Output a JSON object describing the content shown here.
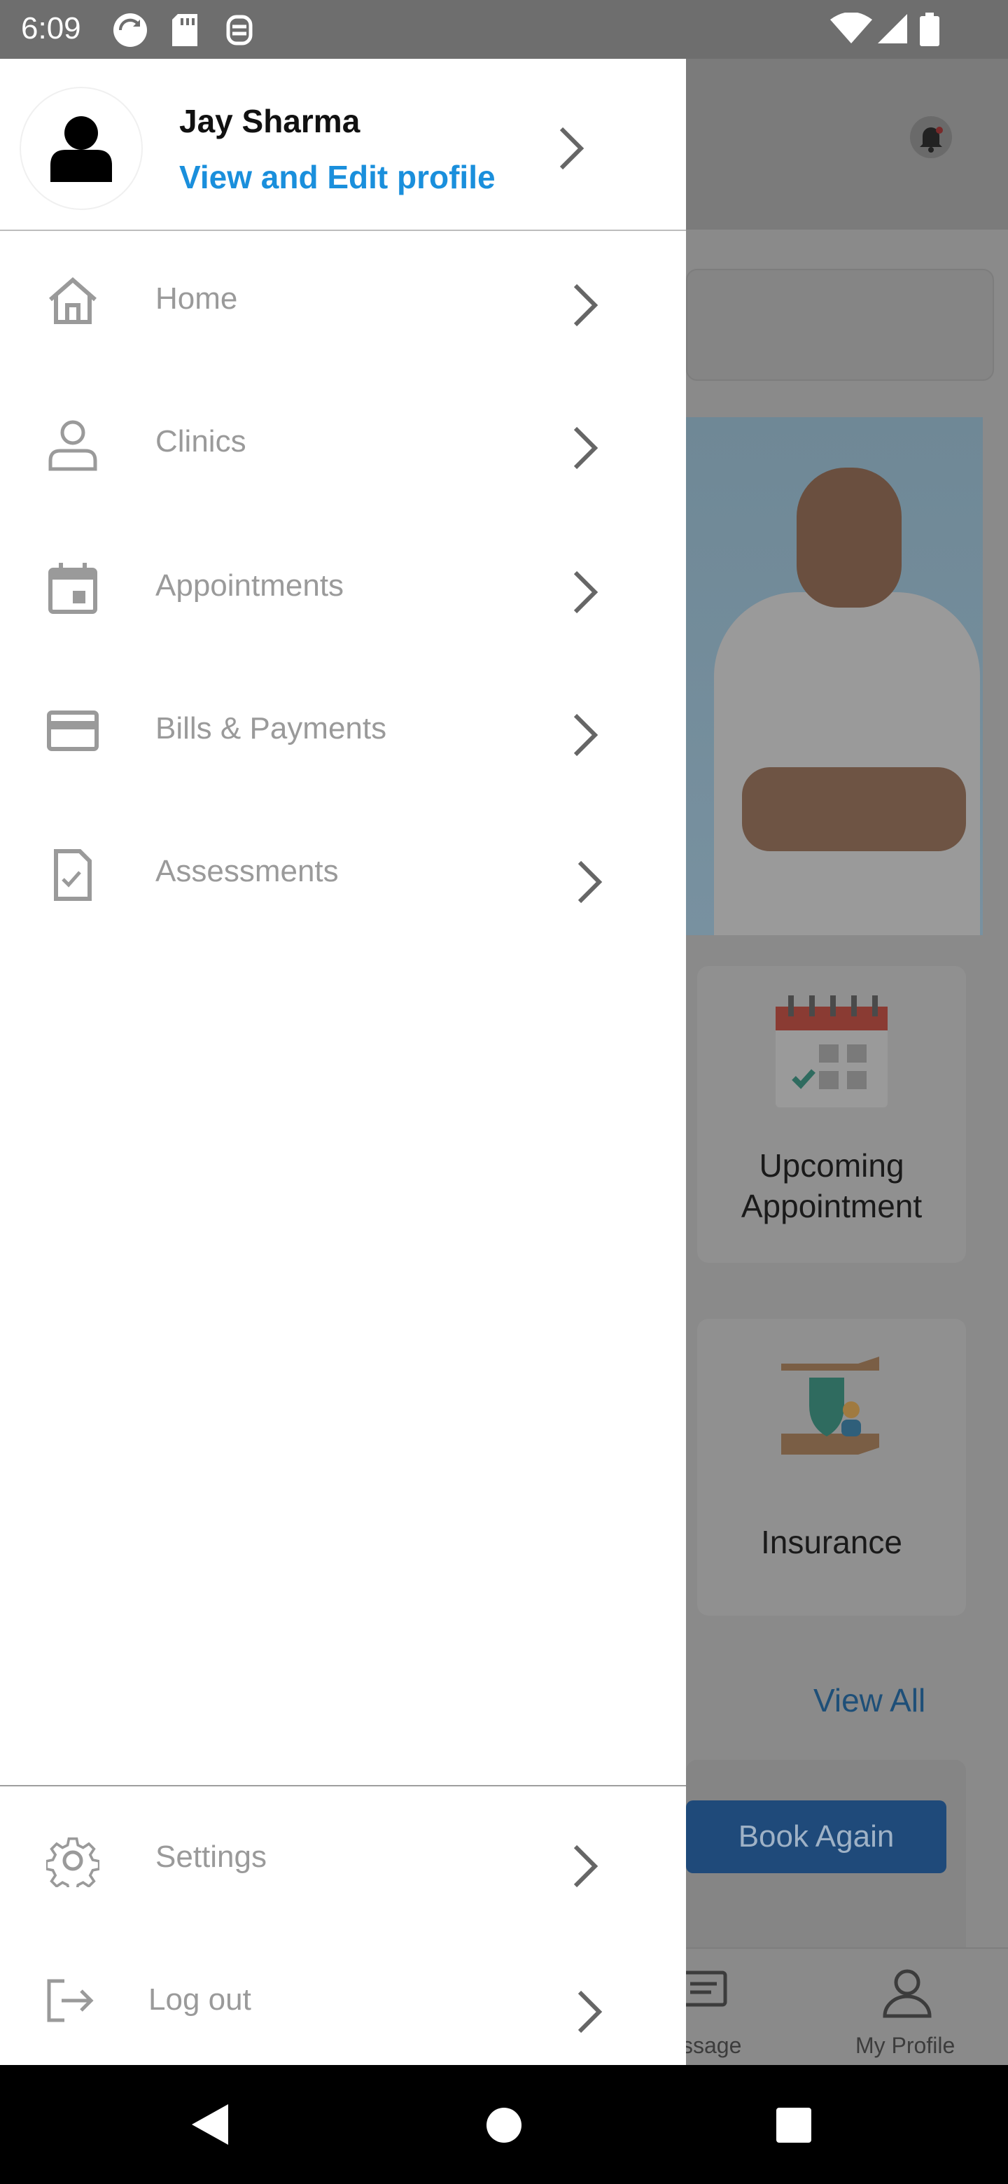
{
  "status_bar": {
    "time": "6:09"
  },
  "drawer": {
    "profile": {
      "name": "Jay Sharma",
      "edit_link": "View and Edit profile"
    },
    "menu": [
      {
        "label": "Home",
        "icon": "home-icon"
      },
      {
        "label": "Clinics",
        "icon": "person-icon"
      },
      {
        "label": "Appointments",
        "icon": "calendar-icon"
      },
      {
        "label": "Bills & Payments",
        "icon": "credit-card-icon"
      },
      {
        "label": "Assessments",
        "icon": "document-check-icon"
      }
    ],
    "footer_menu": [
      {
        "label": "Settings",
        "icon": "gear-icon"
      },
      {
        "label": "Log out",
        "icon": "logout-icon"
      }
    ]
  },
  "background": {
    "cards": [
      {
        "label": "Upcoming Appointment"
      },
      {
        "label": "Insurance"
      }
    ],
    "view_all": "View All",
    "book_again": "Book Again",
    "bottom_nav": {
      "message": "ssage",
      "profile": "My Profile"
    }
  },
  "colors": {
    "accent_link": "#1a8fdc",
    "menu_text": "#9a9a9a",
    "scrim": "#6f6f6f",
    "book_again": "#1f4a7a"
  }
}
